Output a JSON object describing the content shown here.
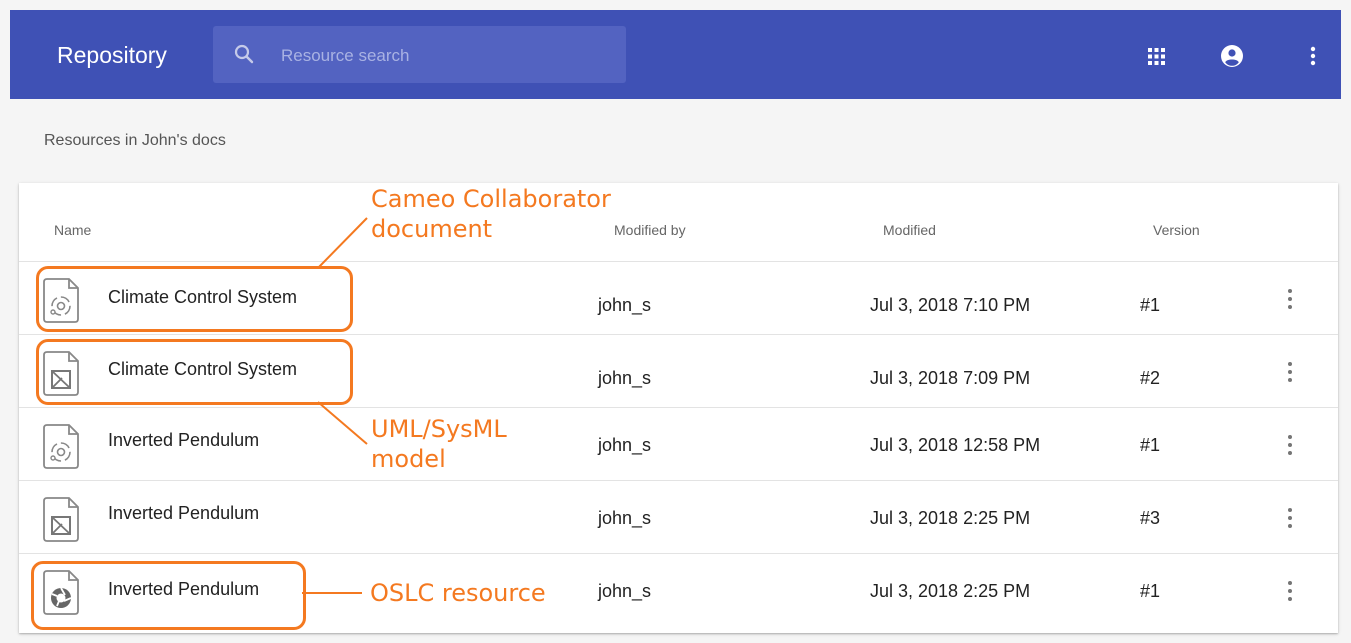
{
  "app": {
    "title": "Repository"
  },
  "search": {
    "placeholder": "Resource search"
  },
  "toolbar": {
    "apps_icon": "apps-grid-icon",
    "account_icon": "account-circle-icon",
    "menu_icon": "more-vert-icon"
  },
  "section": {
    "title": "Resources in John's docs"
  },
  "table": {
    "headers": {
      "name": "Name",
      "modified_by": "Modified by",
      "modified": "Modified",
      "version": "Version"
    },
    "rows": [
      {
        "icon": "collaborator-document-icon",
        "name": "Climate Control System",
        "modified_by": "john_s",
        "modified": "Jul 3, 2018 7:10 PM",
        "version": "#1"
      },
      {
        "icon": "uml-sysml-model-icon",
        "name": "Climate Control System",
        "modified_by": "john_s",
        "modified": "Jul 3, 2018 7:09 PM",
        "version": "#2"
      },
      {
        "icon": "collaborator-document-icon",
        "name": "Inverted Pendulum",
        "modified_by": "john_s",
        "modified": "Jul 3, 2018 12:58 PM",
        "version": "#1"
      },
      {
        "icon": "uml-sysml-model-icon",
        "name": "Inverted Pendulum",
        "modified_by": "john_s",
        "modified": "Jul 3, 2018 2:25 PM",
        "version": "#3"
      },
      {
        "icon": "oslc-resource-icon",
        "name": "Inverted Pendulum",
        "modified_by": "john_s",
        "modified": "Jul 3, 2018 2:25 PM",
        "version": "#1"
      }
    ]
  },
  "annotations": {
    "collaborator": {
      "line1": "Cameo Collaborator",
      "line2": "document"
    },
    "uml": {
      "line1": "UML/SysML",
      "line2": "model"
    },
    "oslc": {
      "line1": "OSLC resource"
    },
    "color": "#f47920"
  },
  "colors": {
    "appbar": "#3f51b5",
    "accent": "#f47920"
  }
}
